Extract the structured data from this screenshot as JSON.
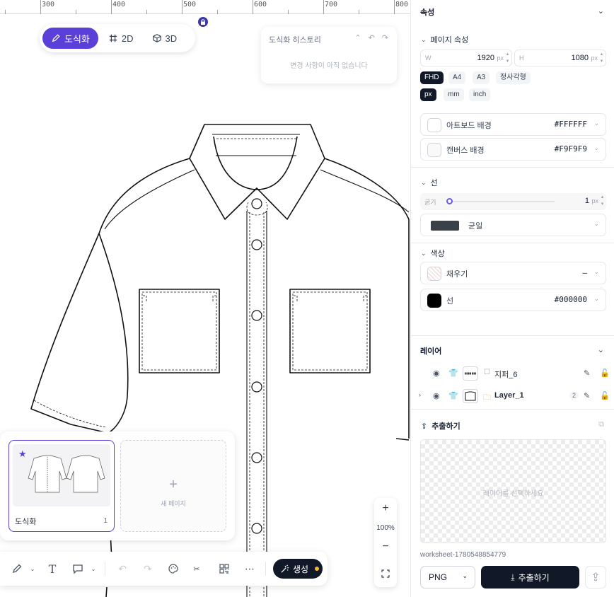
{
  "ruler": {
    "ticks": [
      "300",
      "400",
      "500",
      "600",
      "700",
      "800"
    ]
  },
  "modes": [
    {
      "label": "도식화",
      "icon": "pencil-icon",
      "active": true
    },
    {
      "label": "2D",
      "icon": "grid-icon",
      "active": false
    },
    {
      "label": "3D",
      "icon": "cube-icon",
      "active": false
    }
  ],
  "history": {
    "title": "도식화 히스토리",
    "empty": "변경 사항이 아직 없습니다"
  },
  "pages": {
    "items": [
      {
        "name": "도식화",
        "number": "1",
        "starred": true
      }
    ],
    "new_page_label": "새 페이지"
  },
  "zoom": {
    "in": "+",
    "level": "100%",
    "out": "−"
  },
  "toolbar": {
    "tools": [
      "pen-icon",
      "text-icon",
      "speech-bubble-icon",
      "undo-icon",
      "redo-icon",
      "palette-icon",
      "scissors-icon",
      "qr-icon",
      "more-icon"
    ],
    "generate_label": "생성",
    "accent": "#f5b731"
  },
  "panel": {
    "properties_title": "속성",
    "page_props": {
      "title": "페이지 속성",
      "width_label": "W",
      "width": "1920",
      "width_unit": "px",
      "height_label": "H",
      "height": "1080",
      "height_unit": "px",
      "presets": [
        "FHD",
        "A4",
        "A3",
        "정사각형"
      ],
      "active_preset": "FHD",
      "units": [
        "px",
        "mm",
        "inch"
      ],
      "active_unit": "px",
      "artboard_label": "아트보드 배경",
      "artboard_color": "#FFFFFF",
      "canvas_label": "캔버스 배경",
      "canvas_color": "#F9F9F9"
    },
    "stroke": {
      "title": "선",
      "width_label": "굵기",
      "width": "1",
      "width_unit": "px",
      "style": "균일"
    },
    "color": {
      "title": "색상",
      "fill_label": "채우기",
      "fill_value": "–",
      "stroke_label": "선",
      "stroke_value": "#000000"
    },
    "layers": {
      "title": "레이어",
      "items": [
        {
          "name": "지퍼_6",
          "count": ""
        },
        {
          "name": "Layer_1",
          "count": "2"
        }
      ]
    },
    "export": {
      "title": "추출하기",
      "preview_hint": "레이어를 선택하세요",
      "filename": "worksheet-1780548854779",
      "format": "PNG",
      "button": "추출하기"
    }
  },
  "colors": {
    "brand": "#5b3fd9",
    "dark": "#111827"
  }
}
